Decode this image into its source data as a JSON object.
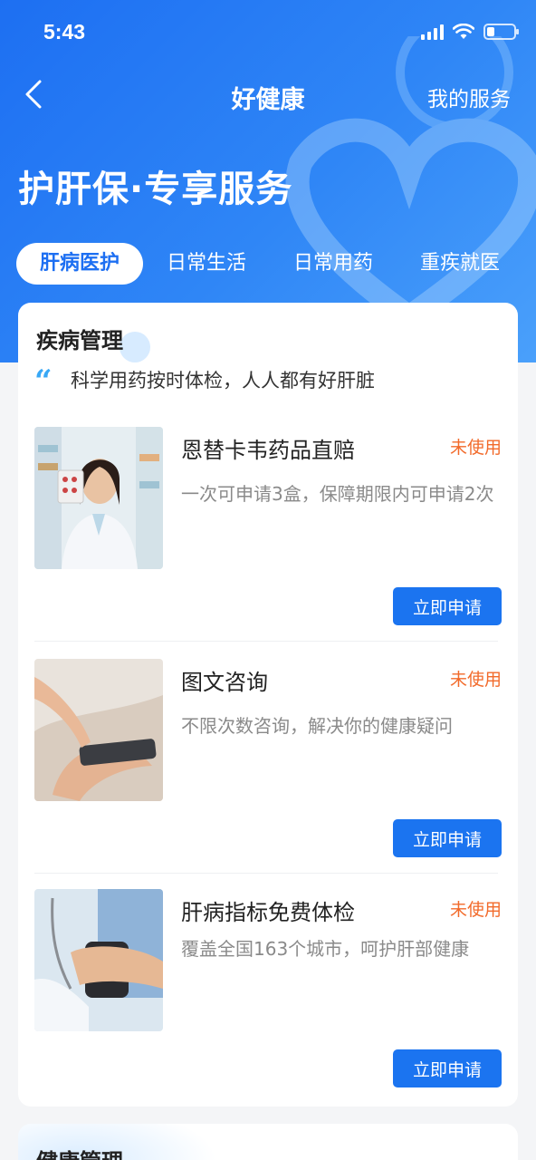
{
  "status_bar": {
    "time": "5:43"
  },
  "nav": {
    "title": "好健康",
    "right_label": "我的服务"
  },
  "hero": {
    "title": "护肝保·专享服务"
  },
  "tabs": [
    {
      "label": "肝病医护",
      "active": true
    },
    {
      "label": "日常生活",
      "active": false
    },
    {
      "label": "日常用药",
      "active": false
    },
    {
      "label": "重疾就医",
      "active": false
    }
  ],
  "section": {
    "title": "疾病管理",
    "quote": "科学用药按时体检，人人都有好肝脏",
    "items": [
      {
        "title": "恩替卡韦药品直赔",
        "status": "未使用",
        "desc": "一次可申请3盒，保障期限内可申请2次",
        "button": "立即申请",
        "image": "pharmacist-holding-pills"
      },
      {
        "title": "图文咨询",
        "status": "未使用",
        "desc": "不限次数咨询，解决你的健康疑问",
        "button": "立即申请",
        "image": "hand-using-phone"
      },
      {
        "title": "肝病指标免费体检",
        "status": "未使用",
        "desc": "覆盖全国163个城市，呵护肝部健康",
        "button": "立即申请",
        "image": "blood-pressure-check"
      }
    ]
  },
  "next_section": {
    "title": "健康管理"
  },
  "colors": {
    "primary": "#1b74f0",
    "status_orange": "#f26a2a",
    "quote_blue": "#38a8f6"
  }
}
